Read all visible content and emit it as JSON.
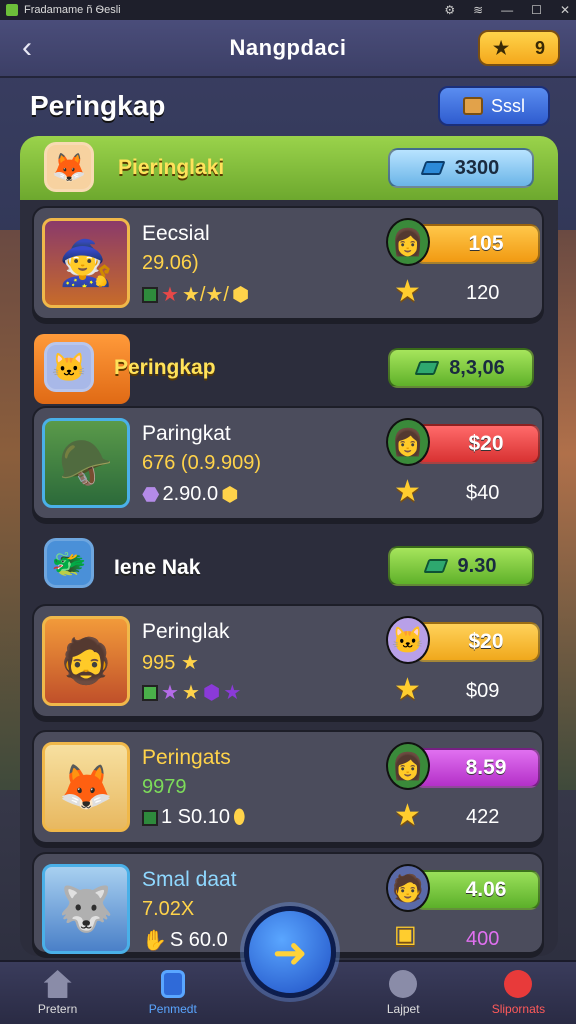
{
  "status_bar": {
    "title": "Fradamame ñ Ѳesli"
  },
  "header": {
    "title": "Nangpdaci",
    "coin_value": "9"
  },
  "page": {
    "title": "Peringkap",
    "top_button_label": "Sssl"
  },
  "groups": [
    {
      "label": "Pieringlaki",
      "value": "3300",
      "color": "#8fd04a"
    },
    {
      "label": "Peringkap",
      "value": "8,3,06",
      "color": "#ff8b2a"
    },
    {
      "label": "Iene Nak",
      "value": "9.30",
      "color": "#5aa6ff"
    }
  ],
  "cards": [
    {
      "name": "Eecsial",
      "sub": "29.06)",
      "sub_color": "#ffd34a",
      "icons_text": "★/★/",
      "score": "105",
      "score_color": "#f4a81c",
      "points": "120"
    },
    {
      "name": "Paringkat",
      "sub": "676 (0.9.909)",
      "sub_color": "#ffd34a",
      "icons_text": "2.90.0",
      "score": "$20",
      "score_color": "#e84848",
      "points": "$40"
    },
    {
      "name": "Peringlak",
      "sub": "995",
      "sub_color": "#ffd34a",
      "icons_text": "",
      "score": "$20",
      "score_color": "#f4b82a",
      "points": "$09"
    },
    {
      "name": "Peringats",
      "sub": "9979",
      "sub_color": "#7ddc5a",
      "icons_text": "1 S0.10",
      "score": "8.59",
      "score_color": "#c84bd8",
      "points": "422"
    },
    {
      "name": "Smal daat",
      "sub": "7.02X",
      "sub_color": "#ffd34a",
      "icons_text": "S 60.0",
      "score": "4.06",
      "score_color": "#6cc23a",
      "points": "400"
    }
  ],
  "bottom_nav": [
    {
      "label": "Pretern",
      "icon": "home-icon"
    },
    {
      "label": "Penmedt",
      "icon": "tablet-icon"
    },
    {
      "label": "",
      "icon": "play-icon"
    },
    {
      "label": "Lajpet",
      "icon": "chat-icon"
    },
    {
      "label": "Slipornats",
      "icon": "profile-icon"
    }
  ]
}
